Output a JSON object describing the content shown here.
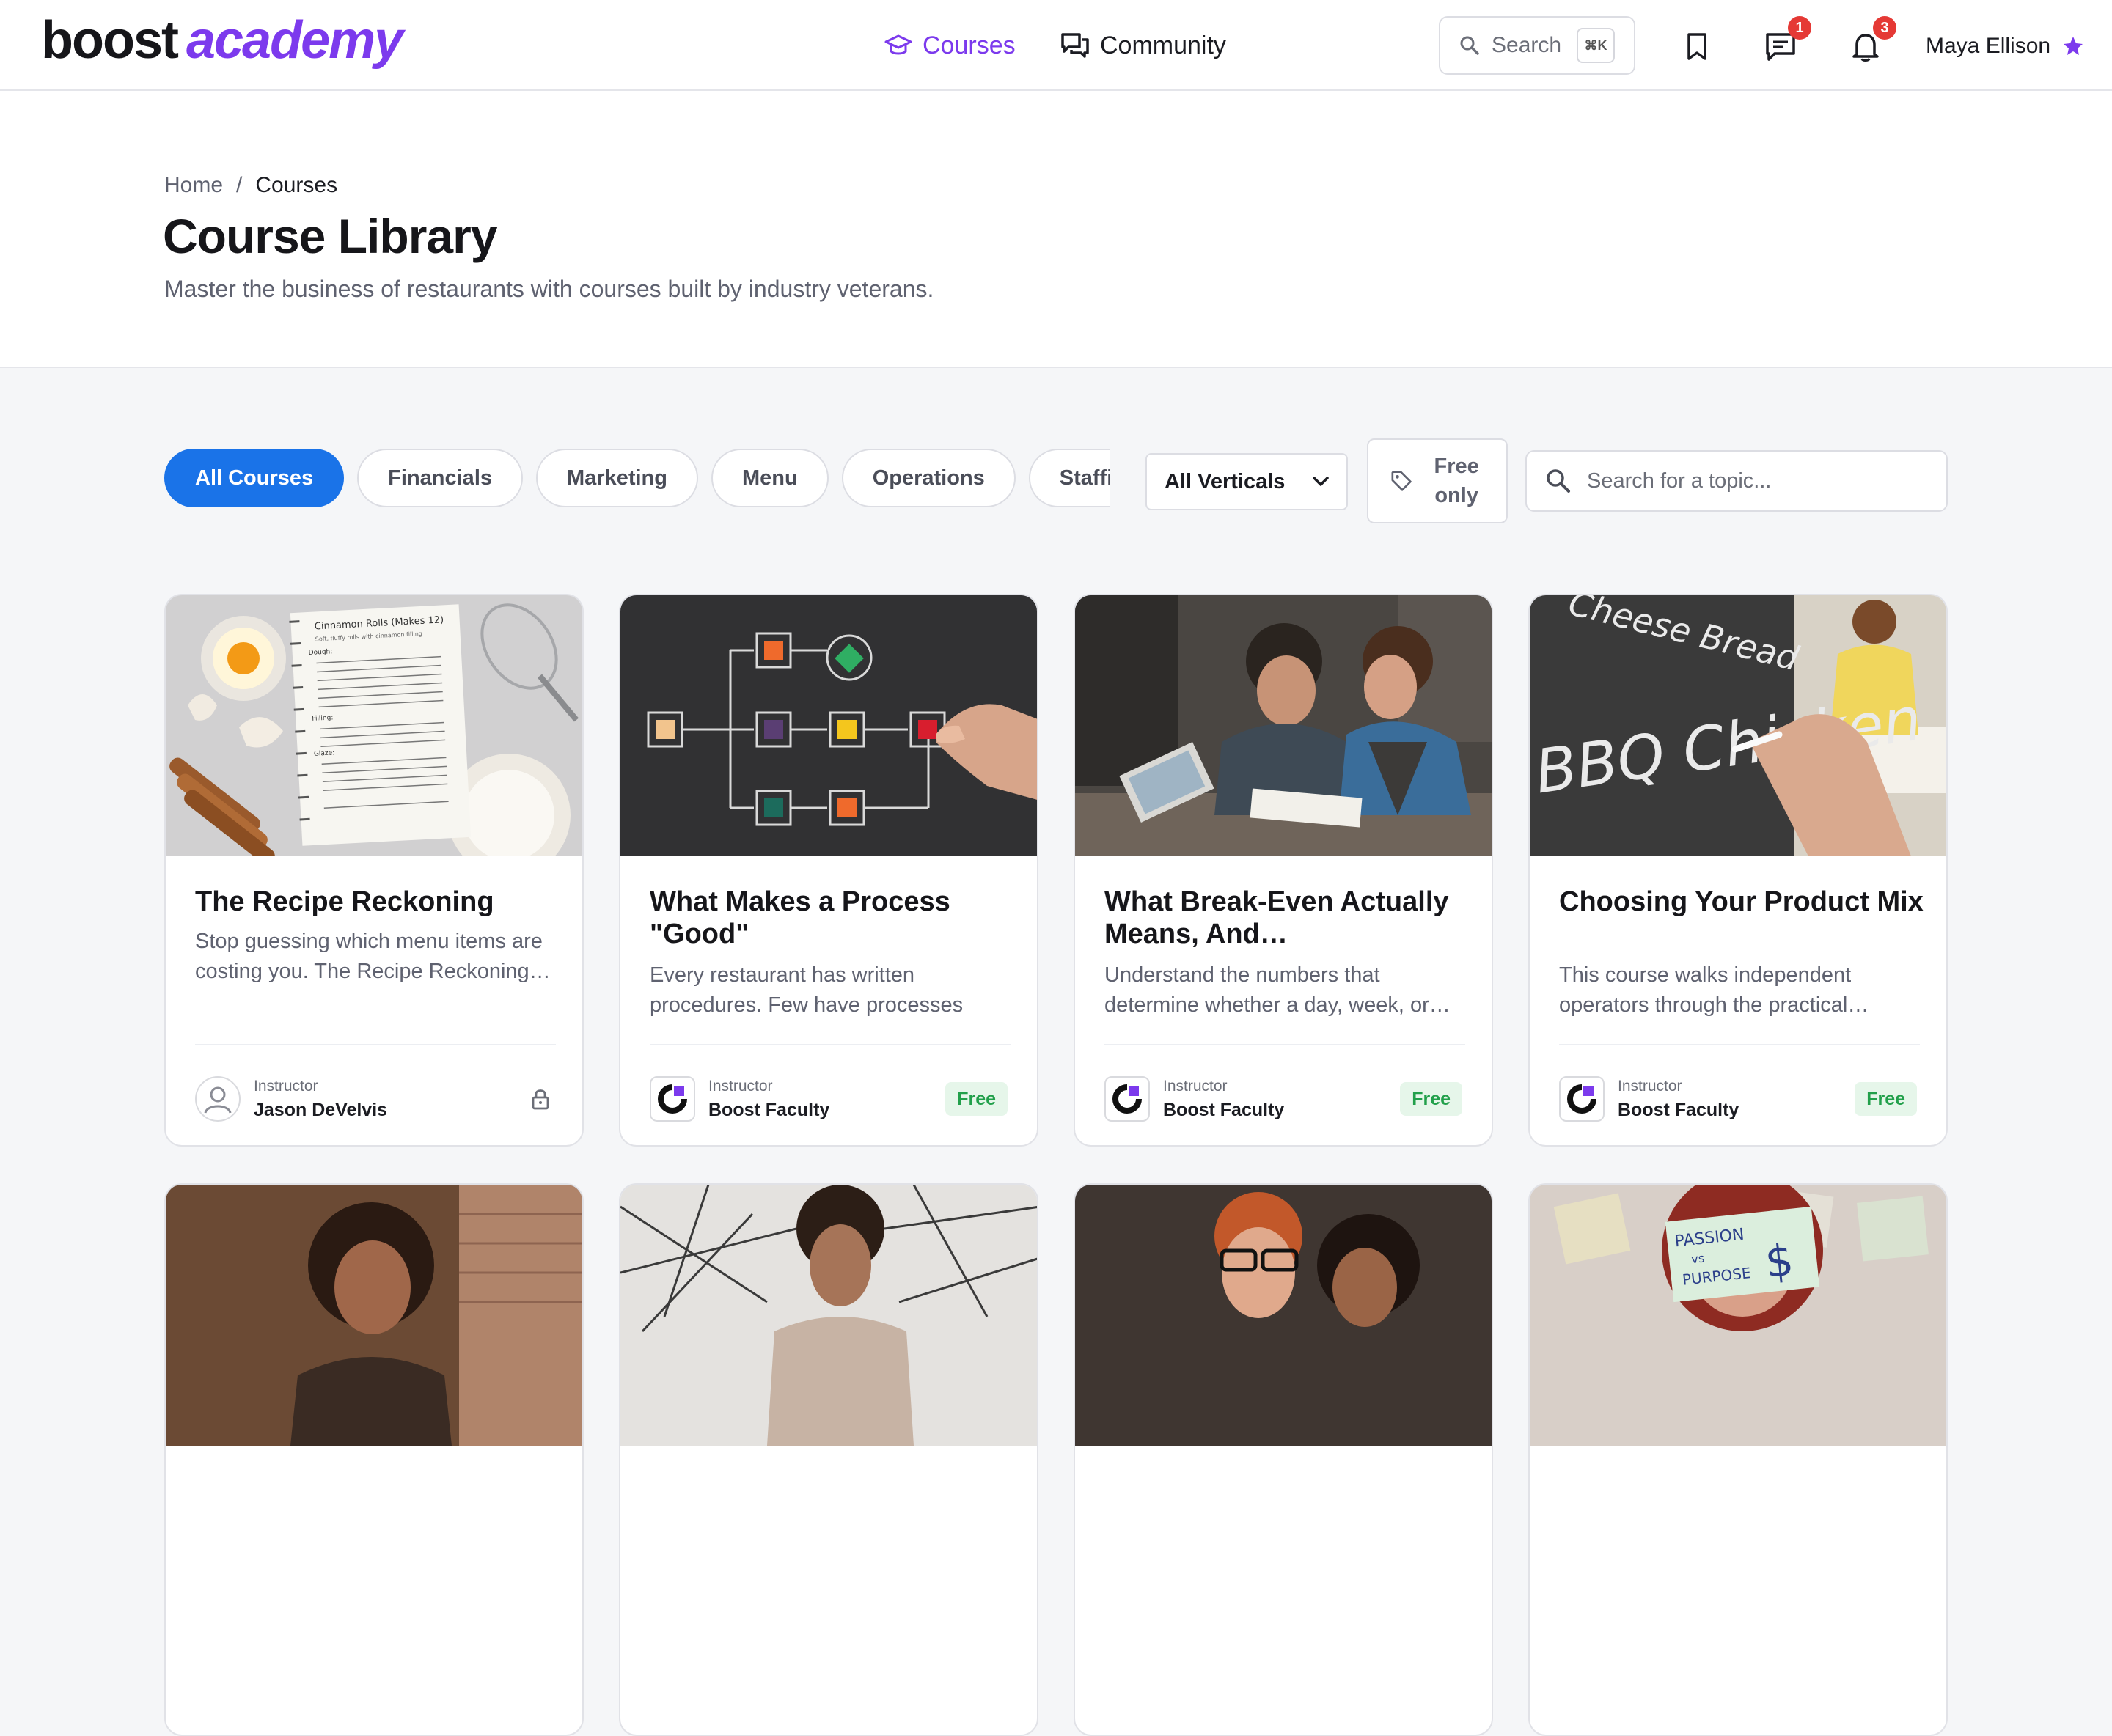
{
  "brand": {
    "word1": "boost",
    "word2": "academy"
  },
  "nav": {
    "courses": "Courses",
    "community": "Community"
  },
  "search": {
    "placeholder": "Search",
    "shortcut": "⌘K"
  },
  "header_icons": {
    "bookmark": "bookmark-icon",
    "messages": "chat-icon",
    "notifications": "bell-icon",
    "messages_badge": "1",
    "notifications_badge": "3"
  },
  "user": {
    "name": "Maya Ellison",
    "icon": "star-icon"
  },
  "breadcrumb": {
    "home": "Home",
    "sep": "/",
    "current": "Courses"
  },
  "page": {
    "title": "Course Library",
    "subtitle": "Master the business of restaurants with courses built by industry veterans."
  },
  "filters": {
    "chips": [
      "All Courses",
      "Financials",
      "Marketing",
      "Menu",
      "Operations",
      "Staffing"
    ],
    "active_chip": "All Courses",
    "vertical": "All Verticals",
    "free_only": "Free only",
    "topic_placeholder": "Search for a topic..."
  },
  "courses": [
    {
      "title": "The Recipe Reckoning",
      "description": "Stop guessing which menu items are costing you. The Recipe Reckoning…",
      "instructor_label": "Instructor",
      "instructor": "Jason DeVelvis",
      "badge": "",
      "locked": true,
      "recipe": {
        "heading": "Cinnamon Rolls (Makes 12)",
        "sub": "Soft, fluffy rolls with cinnamon filling",
        "dough": "Dough:",
        "filling": "Filling:",
        "glaze": "Glaze:"
      }
    },
    {
      "title": "What Makes a Process \"Good\"",
      "description": "Every restaurant has written procedures. Few have processes tha…",
      "instructor_label": "Instructor",
      "instructor": "Boost Faculty",
      "badge": "Free",
      "locked": false
    },
    {
      "title": "What Break-Even Actually Means, And…",
      "description": "Understand the numbers that determine whether a day, week, or…",
      "instructor_label": "Instructor",
      "instructor": "Boost Faculty",
      "badge": "Free",
      "locked": false
    },
    {
      "title": "Choosing Your Product Mix",
      "description": "This course walks independent operators through the practical…",
      "instructor_label": "Instructor",
      "instructor": "Boost Faculty",
      "badge": "Free",
      "locked": false,
      "chalk": {
        "line1": "Cheese Bread",
        "line2": "BBQ Chicken"
      }
    },
    {
      "title": "",
      "description": "",
      "instructor": ""
    },
    {
      "title": "",
      "description": "",
      "instructor": ""
    },
    {
      "title": "",
      "description": "",
      "instructor": ""
    },
    {
      "title": "",
      "description": "",
      "instructor": "",
      "sticky": {
        "line1": "PASSION",
        "line2": "vs",
        "line3": "PURPOSE",
        "dollar": "$"
      }
    }
  ],
  "colors": {
    "accent": "#7c3aed",
    "primary": "#1a73e8",
    "free_green": "#22a04b",
    "badge_red": "#e53935"
  }
}
